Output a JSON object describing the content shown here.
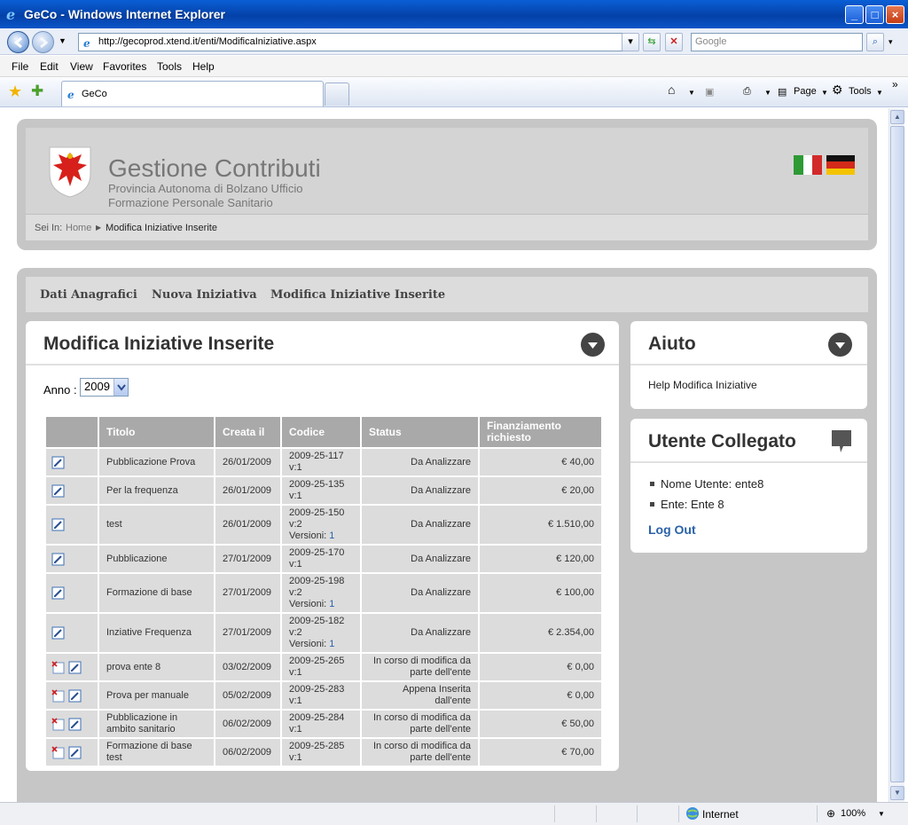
{
  "browser": {
    "window_title": "GeCo - Windows Internet Explorer",
    "url": "http://gecoprod.xtend.it/enti/ModificaIniziative.aspx",
    "search_placeholder": "Google",
    "menu": [
      "File",
      "Edit",
      "View",
      "Favorites",
      "Tools",
      "Help"
    ],
    "tab_label": "GeCo",
    "commands": {
      "page": "Page",
      "tools": "Tools"
    },
    "status": {
      "zone": "Internet",
      "zoom": "100%"
    }
  },
  "header": {
    "title": "Gestione Contributi",
    "subtitle": "Provincia Autonoma di Bolzano Ufficio Formazione Personale Sanitario",
    "breadcrumb_prefix": "Sei In:",
    "breadcrumb_home": "Home",
    "breadcrumb_current": "Modifica Iniziative Inserite"
  },
  "nav": {
    "items": [
      "Dati Anagrafici",
      "Nuova Iniziativa",
      "Modifica Iniziative Inserite"
    ]
  },
  "main_card": {
    "title": "Modifica Iniziative Inserite",
    "anno_label": "Anno :",
    "anno_value": "2009",
    "columns": [
      "Titolo",
      "Creata il",
      "Codice",
      "Status",
      "Finanziamento richiesto"
    ],
    "rows": [
      {
        "titolo": "Pubblicazione Prova",
        "creata": "26/01/2009",
        "codice": "2009-25-117",
        "versione": "v:1",
        "versioni": "",
        "status": "Da Analizzare",
        "fin": "€ 40,00",
        "deletable": false
      },
      {
        "titolo": "Per la frequenza",
        "creata": "26/01/2009",
        "codice": "2009-25-135",
        "versione": "v:1",
        "versioni": "",
        "status": "Da Analizzare",
        "fin": "€ 20,00",
        "deletable": false
      },
      {
        "titolo": "test",
        "creata": "26/01/2009",
        "codice": "2009-25-150",
        "versione": "v:2",
        "versioni": "1",
        "status": "Da Analizzare",
        "fin": "€ 1.510,00",
        "deletable": false
      },
      {
        "titolo": "Pubblicazione",
        "creata": "27/01/2009",
        "codice": "2009-25-170",
        "versione": "v:1",
        "versioni": "",
        "status": "Da Analizzare",
        "fin": "€ 120,00",
        "deletable": false
      },
      {
        "titolo": "Formazione di base",
        "creata": "27/01/2009",
        "codice": "2009-25-198",
        "versione": "v:2",
        "versioni": "1",
        "status": "Da Analizzare",
        "fin": "€ 100,00",
        "deletable": false
      },
      {
        "titolo": "Inziative Frequenza",
        "creata": "27/01/2009",
        "codice": "2009-25-182",
        "versione": "v:2",
        "versioni": "1",
        "status": "Da Analizzare",
        "fin": "€ 2.354,00",
        "deletable": false
      },
      {
        "titolo": "prova ente 8",
        "creata": "03/02/2009",
        "codice": "2009-25-265",
        "versione": "v:1",
        "versioni": "",
        "status": "In corso di modifica da parte dell'ente",
        "fin": "€ 0,00",
        "deletable": true
      },
      {
        "titolo": "Prova per manuale",
        "creata": "05/02/2009",
        "codice": "2009-25-283",
        "versione": "v:1",
        "versioni": "",
        "status": "Appena Inserita dall'ente",
        "fin": "€ 0,00",
        "deletable": true
      },
      {
        "titolo": "Pubblicazione in ambito sanitario",
        "creata": "06/02/2009",
        "codice": "2009-25-284",
        "versione": "v:1",
        "versioni": "",
        "status": "In corso di modifica da parte dell'ente",
        "fin": "€ 50,00",
        "deletable": true
      },
      {
        "titolo": "Formazione di base test",
        "creata": "06/02/2009",
        "codice": "2009-25-285",
        "versione": "v:1",
        "versioni": "",
        "status": "In corso di modifica da parte dell'ente",
        "fin": "€ 70,00",
        "deletable": true
      }
    ],
    "versioni_label": "Versioni:"
  },
  "help_card": {
    "title": "Aiuto",
    "text": "Help Modifica Iniziative"
  },
  "user_card": {
    "title": "Utente Collegato",
    "nome": "Nome Utente: ente8",
    "ente": "Ente: Ente 8",
    "logout": "Log Out"
  },
  "colors": {
    "panel": "#c6c6c6",
    "table_header": "#a9a9a9",
    "table_cell": "#dcdcdc",
    "link": "#2a62a8"
  }
}
